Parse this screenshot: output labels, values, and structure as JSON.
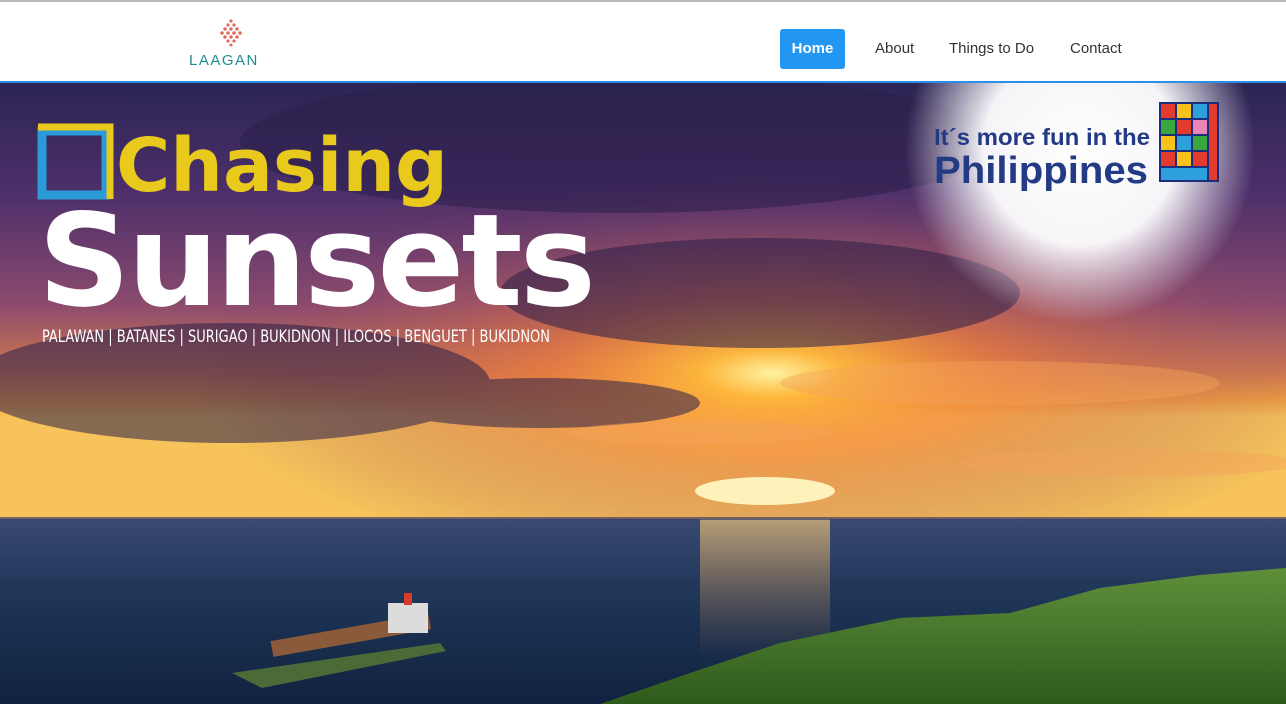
{
  "brand": {
    "logo_text": "LAAGAN"
  },
  "nav": {
    "items": [
      {
        "label": "Home",
        "active": true
      },
      {
        "label": "About",
        "active": false
      },
      {
        "label": "Things to Do",
        "active": false
      },
      {
        "label": "Contact",
        "active": false
      }
    ]
  },
  "hero": {
    "headline_1": "Chasing",
    "headline_2": "Sunsets",
    "destinations": "PALAWAN | BATANES | SURIGAO | BUKIDNON | ILOCOS | BENGUET | BUKIDNON",
    "campaign_line_1": "It´s more fun in the",
    "campaign_line_2": "Philippines"
  },
  "colors": {
    "accent": "#2196f3",
    "nav_border": "#2b8fe8",
    "logo_teal": "#1f8c95",
    "headline_yellow": "#e8c91c",
    "frame_blue": "#2a9bd8",
    "campaign_navy": "#233a84"
  },
  "icons": {
    "logo": "dot-triangle-logo-icon",
    "campaign_logo": "woven-philippines-map-icon"
  }
}
